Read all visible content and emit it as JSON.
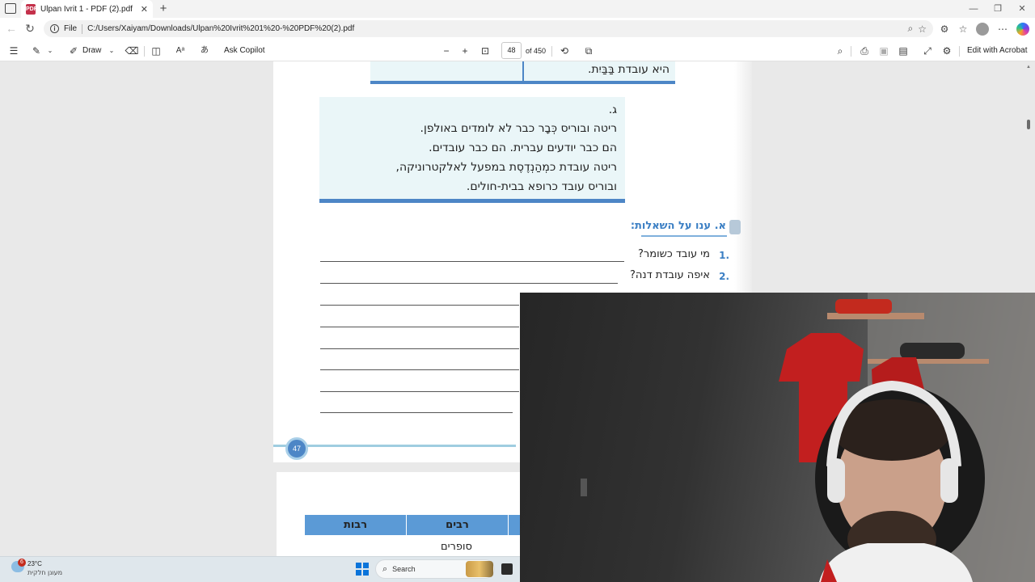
{
  "browser": {
    "tab_title": "Ulpan Ivrit 1 - PDF (2).pdf",
    "address_scheme": "File",
    "url": "C:/Users/Xaiyam/Downloads/Ulpan%20Ivrit%201%20-%20PDF%20(2).pdf"
  },
  "pdf_toolbar": {
    "draw_label": "Draw",
    "ask_copilot_label": "Ask Copilot",
    "page_number": "48",
    "page_total": "of 450",
    "edit_acrobat_label": "Edit with Acrobat"
  },
  "document": {
    "top_line": "היא עובדת בַּבַּיִת.",
    "box_letter": "ג.",
    "box_lines": [
      "ריטה ובוריס כְּבָר כבר לא לומדים באולפן.",
      "הם כבר יודעים עברית. הם כבר עובדים.",
      "ריטה עובדת כמְהַנְדֶסֶת במפעל לאלקטרוניקה,",
      "ובוריס עובד כרופא בבית-חולים."
    ],
    "exercise_title": "א. ענו על השאלות:",
    "questions": [
      {
        "num": ".1",
        "text": "מי עובד כשומר?"
      },
      {
        "num": ".2",
        "text": "איפה עובדת דנה?"
      }
    ],
    "page_badge": "47",
    "table_headers": [
      "רבות",
      "רבים"
    ],
    "table_cell": "סופרים"
  },
  "taskbar": {
    "temperature": "23°C",
    "weather_text": "מעונן חלקית",
    "weather_badge": "6",
    "search_label": "Search"
  },
  "colors": {
    "accent_blue": "#4d86c6",
    "box_bg": "#eaf6f8",
    "table_header_bg": "#5b9ad6"
  }
}
